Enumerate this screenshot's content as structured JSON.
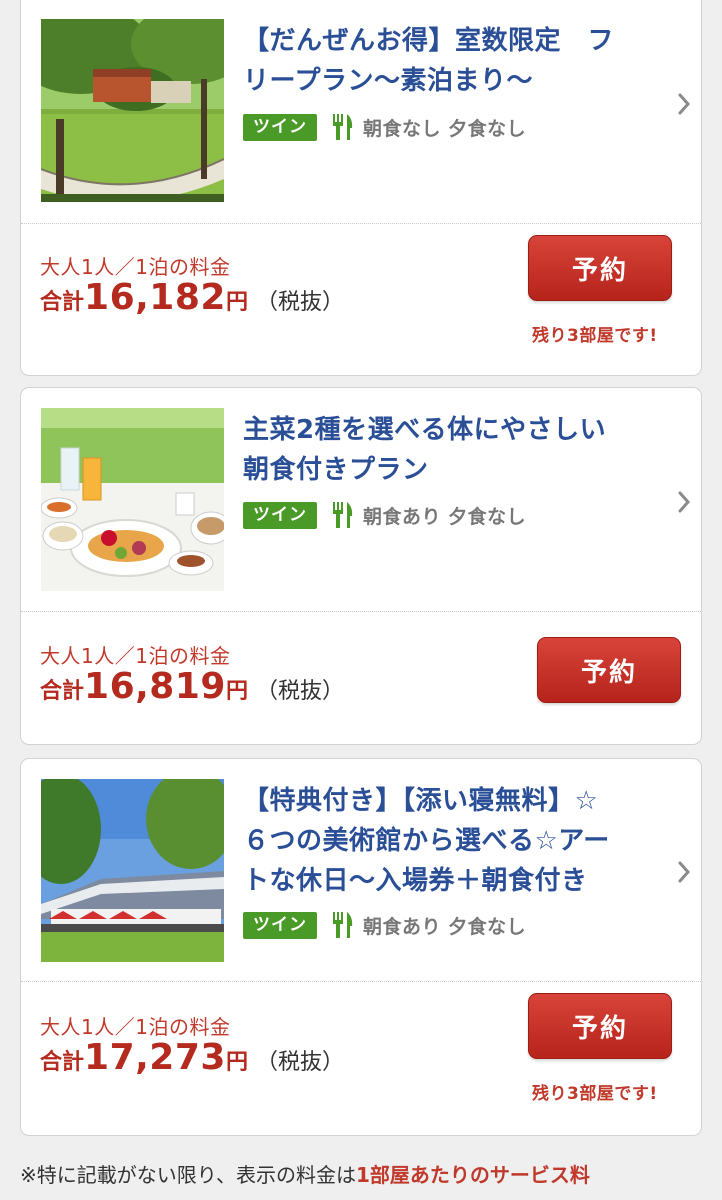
{
  "plans": [
    {
      "title_line1": "【だんぜんお得】室数限定　フ",
      "title_line2": "リープラン〜素泊まり〜",
      "room_type": "ツイン",
      "meals": "朝食なし 夕食なし",
      "price_label": "大人1人／1泊の料金",
      "price_prefix": "合計",
      "price_amount": "16,182",
      "price_unit": "円",
      "price_tax": "（税抜）",
      "reserve_label": "予約",
      "remaining": "残り3部屋です!"
    },
    {
      "title_line1": "主菜2種を選べる体にやさしい",
      "title_line2": "朝食付きプラン",
      "room_type": "ツイン",
      "meals": "朝食あり 夕食なし",
      "price_label": "大人1人／1泊の料金",
      "price_prefix": "合計",
      "price_amount": "16,819",
      "price_unit": "円",
      "price_tax": "（税抜）",
      "reserve_label": "予約"
    },
    {
      "title_line1": "【特典付き】【添い寝無料】☆",
      "title_line2": "６つの美術館から選べる☆アー",
      "title_line3": "トな休日〜入場券＋朝食付き",
      "room_type": "ツイン",
      "meals": "朝食あり 夕食なし",
      "price_label": "大人1人／1泊の料金",
      "price_prefix": "合計",
      "price_amount": "17,273",
      "price_unit": "円",
      "price_tax": "（税抜）",
      "reserve_label": "予約",
      "remaining": "残り3部屋です!"
    }
  ],
  "footnote": {
    "prefix": "※特に記載がない限り、表示の料金は",
    "highlight": "1部屋あたりのサービス料"
  },
  "icons": {
    "meal": "fork-knife-icon",
    "chevron": "chevron-right-icon"
  },
  "colors": {
    "title": "#2a4f97",
    "price": "#b52a1e",
    "room_badge": "#4a9a27",
    "reserve_button": "#c5342a"
  }
}
